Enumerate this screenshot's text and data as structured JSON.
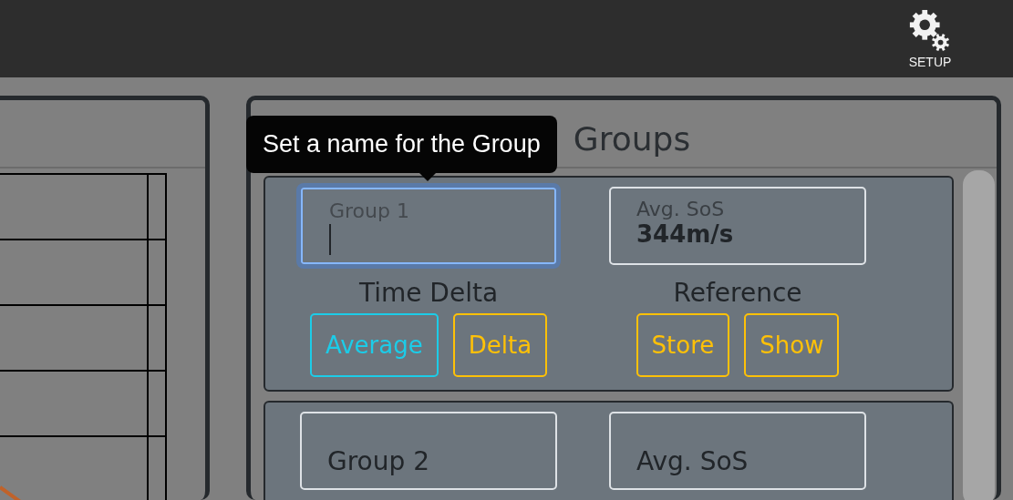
{
  "top_bar": {
    "setup_button": {
      "label": "SETUP"
    }
  },
  "groups_panel": {
    "title": "Groups",
    "tooltip": {
      "text": "Set a name for the Group"
    },
    "groups": [
      {
        "name_field": {
          "label": "Group 1",
          "focused": true
        },
        "sos_field": {
          "label": "Avg. SoS",
          "value": "344m/s"
        },
        "time_delta": {
          "label": "Time Delta",
          "buttons": [
            {
              "label": "Average",
              "selected": true
            },
            {
              "label": "Delta",
              "selected": false
            }
          ]
        },
        "reference": {
          "label": "Reference",
          "buttons": [
            {
              "label": "Store",
              "selected": false
            },
            {
              "label": "Show",
              "selected": false
            }
          ]
        }
      },
      {
        "name_field": {
          "label": "Group 2",
          "focused": false
        },
        "sos_field": {
          "label": "Avg. SoS"
        }
      }
    ]
  }
}
